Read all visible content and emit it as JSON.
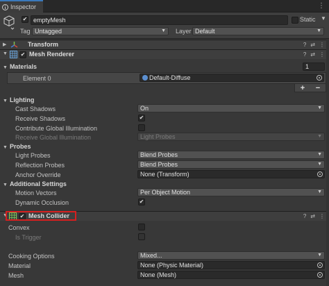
{
  "tab": {
    "title": "Inspector",
    "icon": "info-icon",
    "menu_icon": "kebab-menu-icon"
  },
  "gameobject": {
    "icon": "cube-icon",
    "active_check": "✔",
    "name": "emptyMesh",
    "static_label": "Static",
    "static_arrow": "▼",
    "tag_label": "Tag",
    "tag_value": "Untagged",
    "layer_label": "Layer",
    "layer_value": "Default"
  },
  "components": {
    "transform": {
      "title": "Transform",
      "icon": "transform-axes-icon"
    },
    "mesh_renderer": {
      "title": "Mesh Renderer",
      "icon": "mesh-renderer-icon",
      "check": "✔"
    },
    "mesh_collider": {
      "title": "Mesh Collider",
      "icon": "mesh-collider-icon",
      "check": "✔"
    }
  },
  "header_icons": {
    "help": "?",
    "preset": "⇄",
    "menu": "⋮"
  },
  "materials": {
    "label": "Materials",
    "count": "1",
    "element_label": "Element 0",
    "element_value": "Default-Diffuse",
    "plus": "+",
    "minus": "−"
  },
  "lighting": {
    "label": "Lighting",
    "cast_shadows_label": "Cast Shadows",
    "cast_shadows_value": "On",
    "receive_shadows_label": "Receive Shadows",
    "receive_shadows_check": "✔",
    "contribute_gi_label": "Contribute Global Illumination",
    "receive_gi_label": "Receive Global Illumination",
    "receive_gi_value": "Light Probes"
  },
  "probes": {
    "label": "Probes",
    "light_probes_label": "Light Probes",
    "light_probes_value": "Blend Probes",
    "reflection_probes_label": "Reflection Probes",
    "reflection_probes_value": "Blend Probes",
    "anchor_override_label": "Anchor Override",
    "anchor_override_value": "None (Transform)"
  },
  "additional": {
    "label": "Additional Settings",
    "motion_vectors_label": "Motion Vectors",
    "motion_vectors_value": "Per Object Motion",
    "dynamic_occlusion_label": "Dynamic Occlusion",
    "dynamic_occlusion_check": "✔"
  },
  "collider": {
    "convex_label": "Convex",
    "is_trigger_label": "Is Trigger",
    "cooking_options_label": "Cooking Options",
    "cooking_options_value": "Mixed...",
    "material_label": "Material",
    "material_value": "None (Physic Material)",
    "mesh_label": "Mesh",
    "mesh_value": "None (Mesh)"
  },
  "colors": {
    "highlight": "#d61f1f",
    "accent_tab": "#3a79bb",
    "background": "#383838"
  }
}
